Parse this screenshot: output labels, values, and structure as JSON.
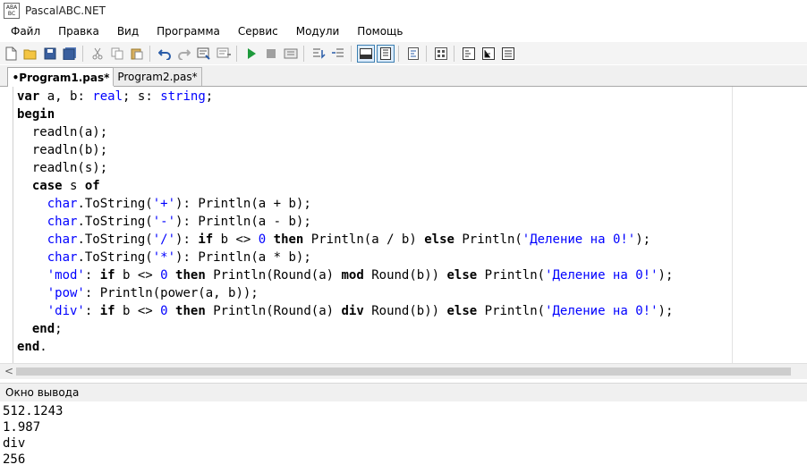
{
  "window": {
    "title": "PascalABC.NET",
    "icon_letters": [
      "A",
      "B",
      "A",
      "B",
      "C"
    ]
  },
  "menu": [
    "Файл",
    "Правка",
    "Вид",
    "Программа",
    "Сервис",
    "Модули",
    "Помощь"
  ],
  "toolbar": {
    "icons": [
      "new-file-icon",
      "open-icon",
      "save-icon",
      "save-all-icon",
      "cut-icon",
      "copy-icon",
      "paste-icon",
      "undo-icon",
      "redo-icon",
      "compile-icon",
      "uncompile-icon",
      "run-icon",
      "stop-icon",
      "debug-icon",
      "step-over-icon",
      "step-into-icon",
      "toggle-output-icon",
      "toggle-panel-icon",
      "format-icon",
      "form-designer-icon",
      "help-icon",
      "view-code-icon",
      "view-tree-icon",
      "view-list-icon"
    ]
  },
  "tabs": [
    {
      "label": "•Program1.pas*",
      "active": true
    },
    {
      "label": "Program2.pas*",
      "active": false
    }
  ],
  "code": [
    [
      [
        "var",
        "kw"
      ],
      [
        " a, b: ",
        ""
      ],
      [
        "real",
        "ty"
      ],
      [
        "; s: ",
        ""
      ],
      [
        "string",
        "ty"
      ],
      [
        ";",
        ""
      ]
    ],
    [
      [
        "begin",
        "kw"
      ]
    ],
    [
      [
        "  readln(a);",
        ""
      ]
    ],
    [
      [
        "  readln(b);",
        ""
      ]
    ],
    [
      [
        "  readln(s);",
        ""
      ]
    ],
    [
      [
        "  ",
        ""
      ],
      [
        "case",
        "kw"
      ],
      [
        " s ",
        ""
      ],
      [
        "of",
        "kw"
      ]
    ],
    [
      [
        "    ",
        ""
      ],
      [
        "char",
        "ty"
      ],
      [
        ".ToString(",
        ""
      ],
      [
        "'+'",
        "st"
      ],
      [
        "): Println(a + b);",
        ""
      ]
    ],
    [
      [
        "    ",
        ""
      ],
      [
        "char",
        "ty"
      ],
      [
        ".ToString(",
        ""
      ],
      [
        "'-'",
        "st"
      ],
      [
        "): Println(a - b);",
        ""
      ]
    ],
    [
      [
        "    ",
        ""
      ],
      [
        "char",
        "ty"
      ],
      [
        ".ToString(",
        ""
      ],
      [
        "'/'",
        "st"
      ],
      [
        "): ",
        ""
      ],
      [
        "if",
        "kw"
      ],
      [
        " b <> ",
        ""
      ],
      [
        "0",
        "st"
      ],
      [
        " ",
        ""
      ],
      [
        "then",
        "kw"
      ],
      [
        " Println(a / b) ",
        ""
      ],
      [
        "else",
        "kw"
      ],
      [
        " Println(",
        ""
      ],
      [
        "'Деление на 0!'",
        "st"
      ],
      [
        ");",
        ""
      ]
    ],
    [
      [
        "    ",
        ""
      ],
      [
        "char",
        "ty"
      ],
      [
        ".ToString(",
        ""
      ],
      [
        "'*'",
        "st"
      ],
      [
        "): Println(a * b);",
        ""
      ]
    ],
    [
      [
        "    ",
        ""
      ],
      [
        "'mod'",
        "st"
      ],
      [
        ": ",
        ""
      ],
      [
        "if",
        "kw"
      ],
      [
        " b <> ",
        ""
      ],
      [
        "0",
        "st"
      ],
      [
        " ",
        ""
      ],
      [
        "then",
        "kw"
      ],
      [
        " Println(Round(a) ",
        ""
      ],
      [
        "mod",
        "kw"
      ],
      [
        " Round(b)) ",
        ""
      ],
      [
        "else",
        "kw"
      ],
      [
        " Println(",
        ""
      ],
      [
        "'Деление на 0!'",
        "st"
      ],
      [
        ");",
        ""
      ]
    ],
    [
      [
        "    ",
        ""
      ],
      [
        "'pow'",
        "st"
      ],
      [
        ": Println(power(a, b));",
        ""
      ]
    ],
    [
      [
        "    ",
        ""
      ],
      [
        "'div'",
        "st"
      ],
      [
        ": ",
        ""
      ],
      [
        "if",
        "kw"
      ],
      [
        " b <> ",
        ""
      ],
      [
        "0",
        "st"
      ],
      [
        " ",
        ""
      ],
      [
        "then",
        "kw"
      ],
      [
        " Println(Round(a) ",
        ""
      ],
      [
        "div",
        "kw"
      ],
      [
        " Round(b)) ",
        ""
      ],
      [
        "else",
        "kw"
      ],
      [
        " Println(",
        ""
      ],
      [
        "'Деление на 0!'",
        "st"
      ],
      [
        ");",
        ""
      ]
    ],
    [
      [
        "  ",
        ""
      ],
      [
        "end",
        "kw"
      ],
      [
        ";",
        ""
      ]
    ],
    [
      [
        "end",
        "kw"
      ],
      [
        ".",
        ""
      ]
    ]
  ],
  "output": {
    "title": "Окно вывода",
    "lines": [
      "512.1243",
      "1.987",
      "div",
      "256"
    ]
  },
  "scroll": {
    "left_arrow": "<"
  }
}
